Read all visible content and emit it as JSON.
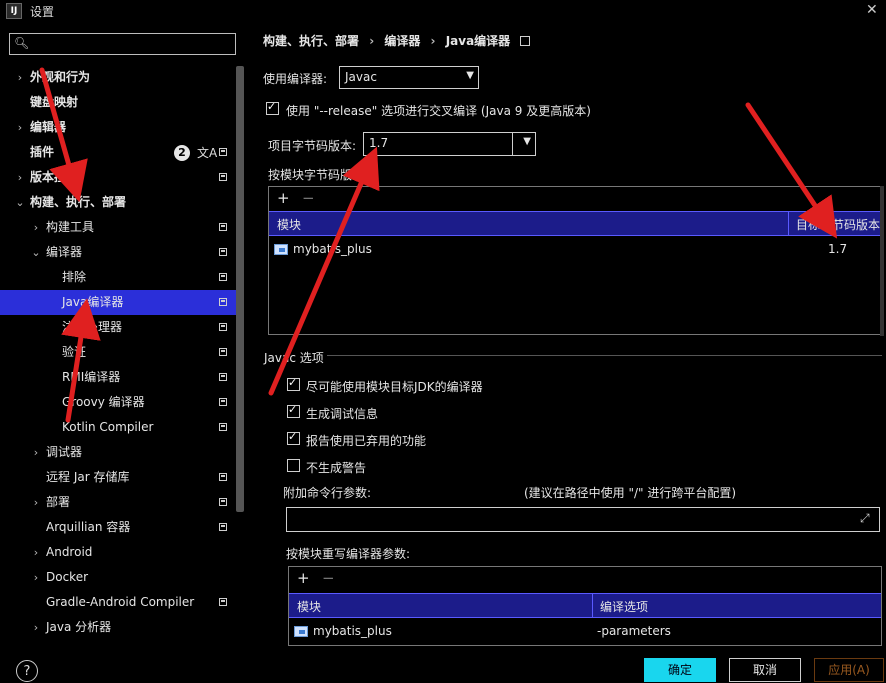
{
  "window": {
    "app_icon": "IJ",
    "title": "设置",
    "close_icon": "close-icon"
  },
  "search": {
    "placeholder": "",
    "icon": "search-icon"
  },
  "sidebar": {
    "plugins_badge": "2",
    "items": [
      {
        "label": "外观和行为",
        "bold": true,
        "chev": "›",
        "project": false
      },
      {
        "label": "键盘映射",
        "bold": true,
        "chev": "",
        "project": false
      },
      {
        "label": "编辑器",
        "bold": true,
        "chev": "›",
        "project": false
      },
      {
        "label": "插件",
        "bold": true,
        "chev": "",
        "project": true
      },
      {
        "label": "版本控制",
        "bold": true,
        "chev": "›",
        "project": true
      },
      {
        "label": "构建、执行、部署",
        "bold": true,
        "chev": "⌄",
        "project": false
      },
      {
        "label": "构建工具",
        "bold": false,
        "chev": "›",
        "project": true
      },
      {
        "label": "编译器",
        "bold": false,
        "chev": "⌄",
        "project": true
      },
      {
        "label": "排除",
        "bold": false,
        "chev": "",
        "project": true
      },
      {
        "label": "Java编译器",
        "bold": false,
        "chev": "",
        "project": true,
        "selected": true
      },
      {
        "label": "注解处理器",
        "bold": false,
        "chev": "",
        "project": true
      },
      {
        "label": "验证",
        "bold": false,
        "chev": "",
        "project": true
      },
      {
        "label": "RMI编译器",
        "bold": false,
        "chev": "",
        "project": true
      },
      {
        "label": "Groovy 编译器",
        "bold": false,
        "chev": "",
        "project": true
      },
      {
        "label": "Kotlin Compiler",
        "bold": false,
        "chev": "",
        "project": true
      },
      {
        "label": "调试器",
        "bold": false,
        "chev": "›",
        "project": false
      },
      {
        "label": "远程 Jar 存储库",
        "bold": false,
        "chev": "",
        "project": true
      },
      {
        "label": "部署",
        "bold": false,
        "chev": "›",
        "project": true
      },
      {
        "label": "Arquillian 容器",
        "bold": false,
        "chev": "",
        "project": true
      },
      {
        "label": "Android",
        "bold": false,
        "chev": "›",
        "project": false
      },
      {
        "label": "Docker",
        "bold": false,
        "chev": "›",
        "project": false
      },
      {
        "label": "Gradle-Android Compiler",
        "bold": false,
        "chev": "",
        "project": true
      },
      {
        "label": "Java 分析器",
        "bold": false,
        "chev": "›",
        "project": false
      }
    ]
  },
  "breadcrumb": [
    "构建、执行、部署",
    "›",
    "编译器",
    "›",
    "Java编译器"
  ],
  "compiler": {
    "label": "使用编译器:",
    "value": "Javac"
  },
  "release_option": {
    "label": "使用 \"--release\" 选项进行交叉编译 (Java 9 及更高版本)",
    "checked": true
  },
  "bytecode": {
    "label": "项目字节码版本:",
    "value": "1.7"
  },
  "per_module": {
    "label": "按模块字节码版本:",
    "add": "+",
    "remove": "−",
    "columns": [
      "模块",
      "目标字节码版本"
    ],
    "rows": [
      {
        "module": "mybatis_plus",
        "version": "1.7"
      }
    ]
  },
  "javac_section": "Javac 选项",
  "javac_options": [
    {
      "label": "尽可能使用模块目标JDK的编译器",
      "checked": true
    },
    {
      "label": "生成调试信息",
      "checked": true
    },
    {
      "label": "报告使用已弃用的功能",
      "checked": true
    },
    {
      "label": "不生成警告",
      "checked": false
    }
  ],
  "extra_args": {
    "label": "附加命令行参数:",
    "hint": "(建议在路径中使用 \"/\" 进行跨平台配置)",
    "value": ""
  },
  "override": {
    "label": "按模块重写编译器参数:",
    "add": "+",
    "remove": "−",
    "columns": [
      "模块",
      "编译选项"
    ],
    "rows": [
      {
        "module": "mybatis_plus",
        "options": "-parameters"
      }
    ]
  },
  "buttons": {
    "help": "?",
    "ok": "确定",
    "cancel": "取消",
    "apply": "应用(A)"
  },
  "colors": {
    "selection": "#2b2fd9",
    "table_header": "#1c1c8a",
    "ok_button": "#19d6ee",
    "annotation_arrow": "#e02020"
  }
}
